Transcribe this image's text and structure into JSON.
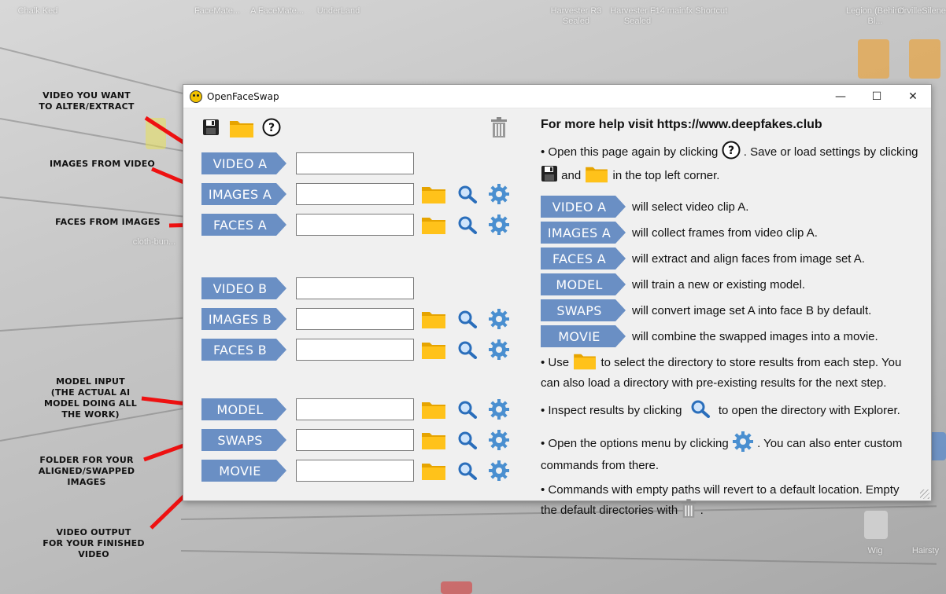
{
  "desktop": {
    "icons": [
      "Chalk Ked",
      "FaceMate...",
      "A FaceMate...",
      "UnderLand",
      "Harvester R3 Sealed",
      "Harvester F14 Sealed",
      "mainfx Shortcut",
      "Legion (Behind Bl...",
      "OrvilleSilene",
      "cloth-bun...",
      "Wig",
      "Hairsty"
    ],
    "accent": "#6a8fc4"
  },
  "annotations": {
    "video_want": "VIDEO YOU WANT\nTO ALTER/EXTRACT",
    "images_from_video": "IMAGES FROM VIDEO",
    "faces_from_images": "FACES FROM IMAGES",
    "model_input": "MODEL INPUT\n(THE ACTUAL AI\nMODEL DOING ALL\nTHE WORK)",
    "folder_aligned": "FOLDER FOR YOUR\nALIGNED/SWAPPED\nIMAGES",
    "video_output": "VIDEO OUTPUT\nFOR YOUR FINISHED\nVIDEO"
  },
  "window": {
    "title": "OpenFaceSwap",
    "minimize": "—",
    "maximize": "☐",
    "close": "✕"
  },
  "toolbar": {
    "icons": [
      "save-icon",
      "folder-icon",
      "help-icon",
      "trash-icon"
    ]
  },
  "steps": [
    {
      "label": "VIDEO A",
      "value": "",
      "has_tools": false
    },
    {
      "label": "IMAGES A",
      "value": "",
      "has_tools": true
    },
    {
      "label": "FACES A",
      "value": "",
      "has_tools": true
    },
    {
      "label": "VIDEO B",
      "value": "",
      "has_tools": false
    },
    {
      "label": "IMAGES B",
      "value": "",
      "has_tools": true
    },
    {
      "label": "FACES B",
      "value": "",
      "has_tools": true
    },
    {
      "label": "MODEL",
      "value": "",
      "has_tools": true
    },
    {
      "label": "SWAPS",
      "value": "",
      "has_tools": true
    },
    {
      "label": "MOVIE",
      "value": "",
      "has_tools": true
    }
  ],
  "help": {
    "title": "For more help visit https://www.deepfakes.club",
    "intro_1": "• Open this page again by clicking",
    "intro_2": ". Save or load settings by clicking",
    "intro_3": "and",
    "intro_4": "in the top left corner.",
    "items": [
      {
        "label": "VIDEO A",
        "text": "will select video clip A."
      },
      {
        "label": "IMAGES A",
        "text": "will collect frames from video clip A."
      },
      {
        "label": "FACES A",
        "text": "will extract and align faces from image set A."
      },
      {
        "label": "MODEL",
        "text": "will train a new or existing model."
      },
      {
        "label": "SWAPS",
        "text": "will convert image set A into face B by default."
      },
      {
        "label": "MOVIE",
        "text": "will combine the swapped images into a movie."
      }
    ],
    "use_1": "• Use",
    "use_2": "to select the directory to store results from each step. You can also load a directory with pre-existing results for the next step.",
    "inspect_1": "• Inspect results by clicking",
    "inspect_2": "to open the directory with Explorer.",
    "options_1": "• Open the options menu by clicking",
    "options_2": ". You can also enter custom commands from there.",
    "empty_1": "• Commands with empty paths will revert to a default location. Empty the default directories with",
    "empty_2": "."
  },
  "colors": {
    "folder": "#f5b800",
    "magnifier": "#2a6ebb",
    "gear": "#4a8fd0",
    "trash": "#8a8a8a"
  }
}
